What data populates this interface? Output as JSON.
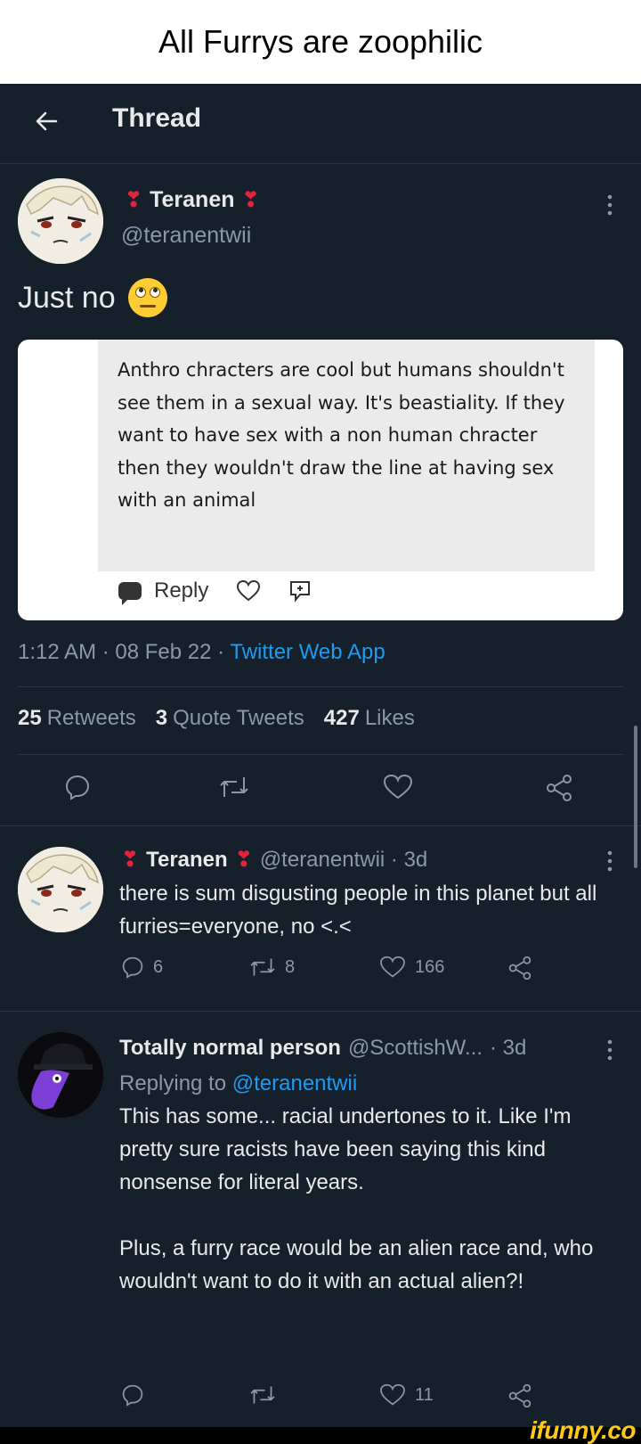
{
  "meme": {
    "caption": "All Furrys are zoophilic",
    "watermark": "ifunny.co"
  },
  "header": {
    "title": "Thread"
  },
  "main_tweet": {
    "author_name": "Teranen",
    "handle": "@teranentwii",
    "text": "Just no",
    "embedded_quote": "Anthro chracters are cool but humans shouldn't see them in a sexual way. It's beastiality. If they want to have sex with a non human chracter then they wouldn't draw the line at having sex with an animal",
    "embedded_reply_label": "Reply",
    "timestamp": "1:12 AM · 08 Feb 22 · ",
    "source": "Twitter Web App",
    "stats": {
      "retweets_count": "25",
      "retweets_label": "Retweets",
      "quotes_count": "3",
      "quotes_label": "Quote Tweets",
      "likes_count": "427",
      "likes_label": "Likes"
    }
  },
  "reply_1": {
    "author_name": "Teranen",
    "handle": "@teranentwii · 3d",
    "text": "there is sum disgusting people in this planet but all furries=everyone, no <.<",
    "reply_count": "6",
    "retweet_count": "8",
    "like_count": "166"
  },
  "reply_2": {
    "author_name": "Totally normal person",
    "handle": "@ScottishW...",
    "time": "· 3d",
    "replying_prefix": "Replying to",
    "replying_mention": "@teranentwii",
    "text_p1": "This has some... racial undertones to it. Like I'm pretty sure racists have been saying this kind nonsense for literal years.",
    "text_p2": "Plus, a furry race would be an alien race and, who wouldn't want to do it with an actual alien?!",
    "like_count": "11"
  },
  "colors": {
    "background": "#15202b",
    "accent": "#1d9bf0",
    "muted": "#8b98a5",
    "heart": "#e0243b"
  }
}
